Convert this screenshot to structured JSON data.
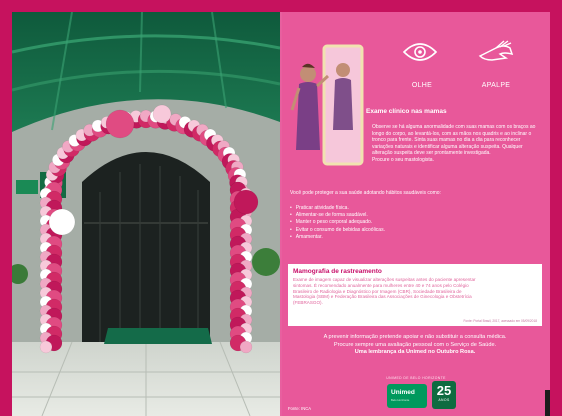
{
  "photo": {
    "sign_number": "25",
    "sign_word": "ANOS"
  },
  "poster": {
    "icons": {
      "eye": "eye-icon",
      "hand": "hand-icon"
    },
    "olhe_label": "OLHE",
    "apalpe_label": "APALPE",
    "exam_title": "Exame clínico nas mamas",
    "exam_lines": [
      "Observe se há alguma anormalidade com suas mamas com os braços ao",
      "longo do corpo, ao levantá-los, com as mãos nos quadris e ao inclinar o",
      "tronco para frente. Sinta suas mamas no dia a dia para reconhecer",
      "variações naturais e identificar alguma alteração suspeita. Qualquer",
      "alteração suspeita deve ser prontamente investigada.",
      "Procure o seu mastologista."
    ],
    "protect_text": "Você pode proteger a sua saúde adotando hábitos saudáveis como:",
    "habits": [
      "Praticar atividade física.",
      "Alimentar-se de forma saudável.",
      "Manter o peso corporal adequado.",
      "Evitar o consumo de bebidas alcoólicas.",
      "Amamentar."
    ],
    "box_title": "Mamografia de rastreamento",
    "box_lines": [
      "Exame de imagem capaz de visualizar alterações suspeitas antes do paciente apresentar",
      "sintomas. É recomendado anualmente para mulheres entre 40 e 74 anos pelo Colégio",
      "Brasileiro de Radiologia e Diagnóstico por Imagem (CBR), Sociedade Brasileira de",
      "Mastologia (SBM) e Federação Brasileira das Associações de Ginecologia e Obstetrícia",
      "(FEBRASGO)."
    ],
    "box_source": "Fonte: Portal Brasil, 2017, acessado em 05/09/2018",
    "notice_line1": "A prevenir informação pretende apoiar e não substituir a consulta médica.",
    "notice_line2": "Procure sempre uma avaliação pessoal com o Serviço de Saúde.",
    "notice_line3": "Uma lembrança da Unimed no Outubro Rosa.",
    "logo_caption": "UNIMED DE BELO HORIZONTE",
    "logo_name": "Unimed",
    "logo_sub": "Belo Horizonte",
    "anos_number": "25",
    "anos_word": "ANOS",
    "source": "Fonte: INCA"
  },
  "colors": {
    "border": "#c6125e",
    "poster_bg": "#e8589a",
    "unimed_green": "#00995d"
  }
}
